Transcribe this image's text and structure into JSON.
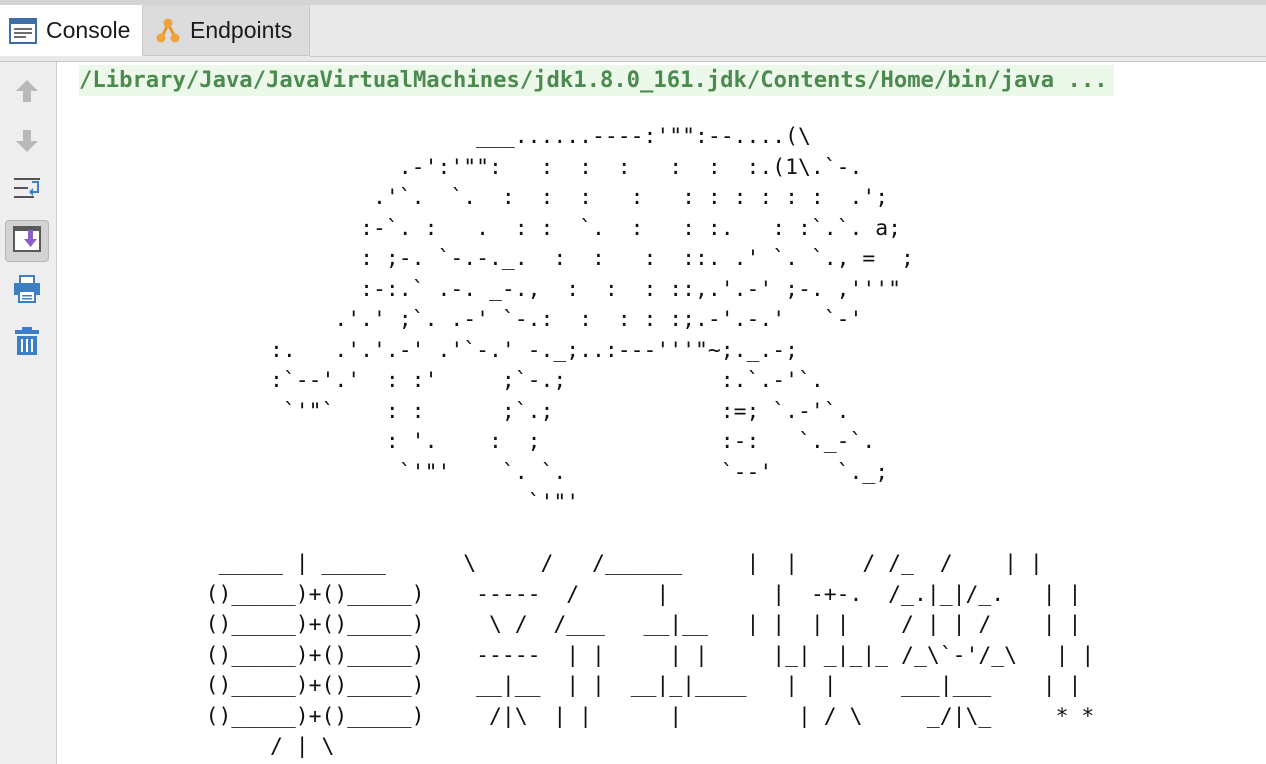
{
  "tabs": [
    {
      "label": "Console",
      "icon": "console-icon",
      "active": true
    },
    {
      "label": "Endpoints",
      "icon": "endpoints-icon",
      "active": false
    }
  ],
  "toolbar": [
    {
      "name": "up-arrow-icon"
    },
    {
      "name": "down-arrow-icon"
    },
    {
      "name": "soft-wrap-icon"
    },
    {
      "name": "scroll-to-end-icon",
      "active": true
    },
    {
      "name": "print-icon"
    },
    {
      "name": "trash-icon"
    }
  ],
  "console": {
    "command_line": "/Library/Java/JavaVirtualMachines/jdk1.8.0_161.jdk/Contents/Home/bin/java ...",
    "ascii_art": "                        ___......----:'\"\":--....(\\\n                  .-':'\"\":   :  :  :   :  :  :.(1\\.`-.\n                .'`.  `.  :  :  :   :   : : : : : :  .';\n               :-`. :   .  : :  `.  :   : :.   : :`.`. a;\n               : ;-. `-.-._.  :  :   :  ::. .' `. `., =  ;\n               :-:.` .-. _-.,  :  :  : ::,.'.-' ;-. ,'''\"\n             .'.' ;`. .-' `-.:  :  : : :;.-'.-.'   `-'\n        :.   .'.'.-' .'`-.' -._;..:---'''\"~;._.-;\n        :`--'.'  : :'     ;`-.;            :.`.-'`.\n         `'\"`    : :      ;`.;             :=; `.-'`.\n                 : '.    :  ;              :-:   `._-`.\n                  `'\"'    `. `.            `--'     `._;\n                            `'\"'\n\n    _____ | _____      \\     /   /______     |  |     / /_  /    | |\n   ()_____)+()_____)    -----  /      |        |  -+-.  /_.|_|/_.   | |\n   ()_____)+()_____)     \\ /  /___   __|__   | |  | |    / | | /    | |\n   ()_____)+()_____)    -----  | |     | |     |_| _|_|_ /_\\`-'/_\\   | |\n   ()_____)+()_____)    __|__  | |  __|_|____   |  |     ___|___    | |\n   ()_____)+()_____)     /|\\  | |      |         | / \\     _/|\\_     * *\n        / | \\"
  }
}
